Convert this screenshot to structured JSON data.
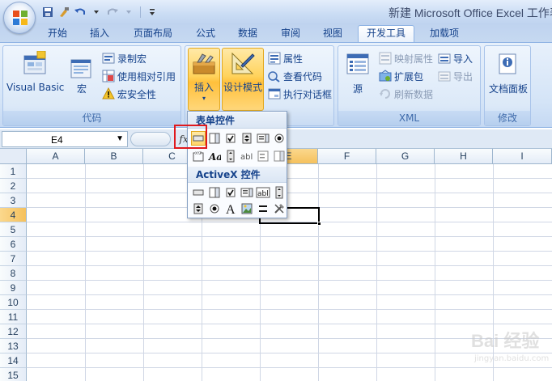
{
  "window": {
    "title": "新建 Microsoft Office Excel 工作表"
  },
  "tabs": [
    "开始",
    "插入",
    "页面布局",
    "公式",
    "数据",
    "审阅",
    "视图",
    "开发工具",
    "加载项"
  ],
  "active_tab": "开发工具",
  "ribbon": {
    "code": {
      "label": "代码",
      "visual_basic": "Visual Basic",
      "macro": "宏",
      "record_macro": "录制宏",
      "relative_ref": "使用相对引用",
      "macro_security": "宏安全性"
    },
    "controls": {
      "insert": "插入",
      "design_mode": "设计模式",
      "properties": "属性",
      "view_code": "查看代码",
      "run_dialog": "执行对话框"
    },
    "xml": {
      "label": "XML",
      "source": "源",
      "map_props": "映射属性",
      "expansion_pack": "扩展包",
      "refresh_data": "刷新数据",
      "import": "导入",
      "export": "导出"
    },
    "modify": {
      "label": "修改",
      "doc_panel": "文档面板"
    }
  },
  "formula_bar": {
    "name_box": "E4",
    "fx": "fx"
  },
  "columns": [
    "A",
    "B",
    "C",
    "D",
    "E",
    "F",
    "G",
    "H",
    "I"
  ],
  "rows": [
    "1",
    "2",
    "3",
    "4",
    "5",
    "6",
    "7",
    "8",
    "9",
    "10",
    "11",
    "12",
    "13",
    "14",
    "15"
  ],
  "selected": {
    "column": "E",
    "row": "4"
  },
  "insert_menu": {
    "form_controls": "表单控件",
    "activex_controls": "ActiveX 控件"
  },
  "watermark": {
    "text": "Bai 经验",
    "sub": "jingyan.baidu.com"
  },
  "colors": {
    "accent": "#15428b",
    "highlight": "#ffd35c",
    "red_box": "#e0191d"
  }
}
